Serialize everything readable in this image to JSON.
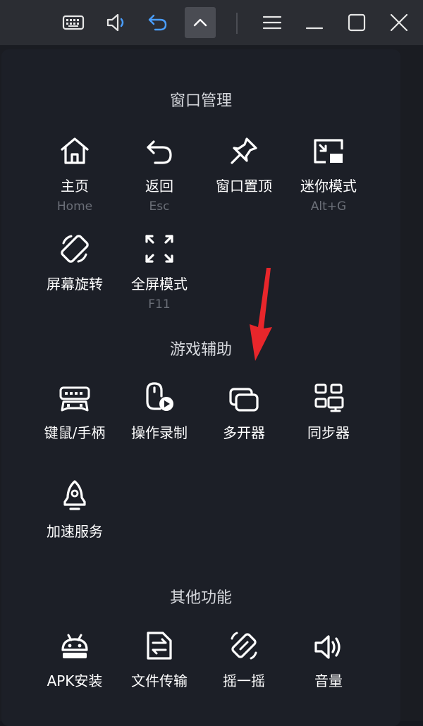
{
  "sections": {
    "window": "窗口管理",
    "game": "游戏辅助",
    "other": "其他功能"
  },
  "window_items": [
    {
      "label": "主页",
      "sub": "Home"
    },
    {
      "label": "返回",
      "sub": "Esc"
    },
    {
      "label": "窗口置顶",
      "sub": ""
    },
    {
      "label": "迷你模式",
      "sub": "Alt+G"
    },
    {
      "label": "屏幕旋转",
      "sub": ""
    },
    {
      "label": "全屏模式",
      "sub": "F11"
    }
  ],
  "game_items": [
    {
      "label": "键鼠/手柄"
    },
    {
      "label": "操作录制"
    },
    {
      "label": "多开器"
    },
    {
      "label": "同步器"
    },
    {
      "label": "加速服务"
    }
  ],
  "other_items": [
    {
      "label": "APK安装"
    },
    {
      "label": "文件传输"
    },
    {
      "label": "摇一摇"
    },
    {
      "label": "音量"
    }
  ],
  "colors": {
    "accent_arrow": "#e8262b",
    "panel_bg": "#1c1f27",
    "titlebar_bg": "#2b2d33",
    "icon_blue": "#4a9eff"
  }
}
